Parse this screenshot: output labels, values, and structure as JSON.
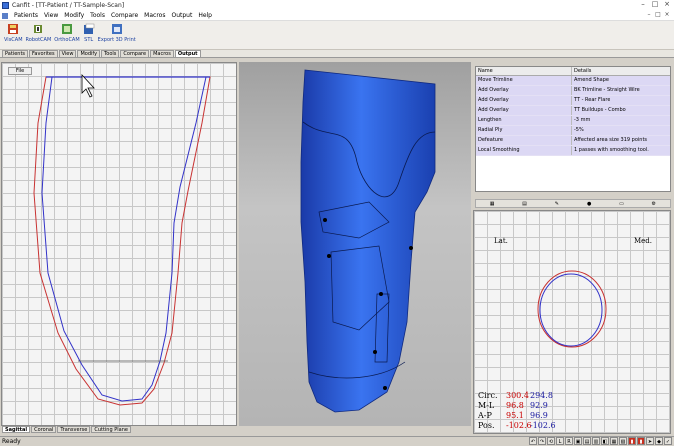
{
  "window": {
    "title": "Canfit - [TT-Patient / TT-Sample-Scan]",
    "controls": [
      "–",
      "□",
      "×"
    ]
  },
  "menu": [
    "Patients",
    "View",
    "Modify",
    "Tools",
    "Compare",
    "Macros",
    "Output",
    "Help"
  ],
  "toolbar": [
    {
      "label": "VisCAM",
      "icon": "viscam-icon"
    },
    {
      "label": "RobotCAM",
      "icon": "robotcam-icon"
    },
    {
      "label": "OrthoCAM",
      "icon": "orthocam-icon"
    },
    {
      "label": "STL",
      "icon": "stl-icon"
    },
    {
      "label": "Export 3D Print",
      "icon": "3d-print-icon"
    }
  ],
  "ribbon_tabs": [
    "Patients",
    "Favorites",
    "View",
    "Modify",
    "Tools",
    "Compare",
    "Macros",
    "Output"
  ],
  "active_tab": "Output",
  "left_pane": {
    "file_button": "File"
  },
  "view_tabs": [
    "Sagittal",
    "Coronal",
    "Transverse",
    "Cutting Plane"
  ],
  "operations": {
    "headers": [
      "Name",
      "Details"
    ],
    "rows": [
      {
        "name": "Move Trimline",
        "detail": "Amend Shape"
      },
      {
        "name": "Add Overlay",
        "detail": "BK Trimline - Straight Wire"
      },
      {
        "name": "Add Overlay",
        "detail": "TT - Rear Flare"
      },
      {
        "name": "Add Overlay",
        "detail": "TT Buildups - Combo"
      },
      {
        "name": "Lengthen",
        "detail": "-3 mm"
      },
      {
        "name": "Radial Ply",
        "detail": "-5%"
      },
      {
        "name": "Defeature",
        "detail": "Affected area size 319 points"
      },
      {
        "name": "Local Smoothing",
        "detail": "1 passes with smoothing tool."
      }
    ]
  },
  "cross_section": {
    "lateral": "Lat.",
    "medial": "Med."
  },
  "measurements": [
    {
      "label": "Circ.",
      "red": "300.4",
      "blue": "294.8"
    },
    {
      "label": "M-L",
      "red": "96.8",
      "blue": "92.9"
    },
    {
      "label": "A-P",
      "red": "95.1",
      "blue": "96.9"
    },
    {
      "label": "Pos.",
      "red": "-102.6",
      "blue": "-102.6"
    }
  ],
  "status": "Ready",
  "status_icons": [
    "L",
    "R"
  ],
  "colors": {
    "red_profile": "#c83232",
    "blue_profile": "#3232c8",
    "model_blue": "#2a5ad8"
  }
}
